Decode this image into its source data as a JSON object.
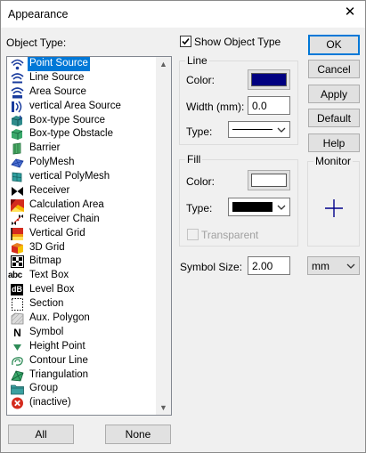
{
  "window": {
    "title": "Appearance",
    "close_glyph": "✕"
  },
  "object_type_label": "Object Type:",
  "object_types": [
    {
      "label": "Point Source",
      "icon": "point-source-icon",
      "selected": true
    },
    {
      "label": "Line Source",
      "icon": "line-source-icon"
    },
    {
      "label": "Area Source",
      "icon": "area-source-icon"
    },
    {
      "label": "vertical Area Source",
      "icon": "vertical-area-source-icon"
    },
    {
      "label": "Box-type Source",
      "icon": "box-source-icon"
    },
    {
      "label": "Box-type Obstacle",
      "icon": "box-obstacle-icon"
    },
    {
      "label": "Barrier",
      "icon": "barrier-icon"
    },
    {
      "label": "PolyMesh",
      "icon": "polymesh-icon"
    },
    {
      "label": "vertical PolyMesh",
      "icon": "vertical-polymesh-icon"
    },
    {
      "label": "Receiver",
      "icon": "receiver-icon"
    },
    {
      "label": "Calculation Area",
      "icon": "calculation-area-icon"
    },
    {
      "label": "Receiver Chain",
      "icon": "receiver-chain-icon"
    },
    {
      "label": "Vertical Grid",
      "icon": "vertical-grid-icon"
    },
    {
      "label": "3D Grid",
      "icon": "3d-grid-icon"
    },
    {
      "label": "Bitmap",
      "icon": "bitmap-icon"
    },
    {
      "label": "Text Box",
      "icon": "text-box-icon",
      "icon_text": "abc"
    },
    {
      "label": "Level Box",
      "icon": "level-box-icon",
      "icon_text": "dB"
    },
    {
      "label": "Section",
      "icon": "section-icon"
    },
    {
      "label": "Aux. Polygon",
      "icon": "aux-polygon-icon"
    },
    {
      "label": "Symbol",
      "icon": "symbol-icon",
      "icon_text": "N"
    },
    {
      "label": "Height Point",
      "icon": "height-point-icon"
    },
    {
      "label": "Contour Line",
      "icon": "contour-line-icon"
    },
    {
      "label": "Triangulation",
      "icon": "triangulation-icon"
    },
    {
      "label": "Group",
      "icon": "group-icon"
    },
    {
      "label": "(inactive)",
      "icon": "inactive-icon"
    }
  ],
  "buttons": {
    "all": "All",
    "none": "None",
    "ok": "OK",
    "cancel": "Cancel",
    "apply": "Apply",
    "default": "Default",
    "help": "Help"
  },
  "show_object_type": {
    "label": "Show Object Type",
    "checked": true
  },
  "line": {
    "group_label": "Line",
    "color_label": "Color:",
    "color": "#000080",
    "width_label": "Width (mm):",
    "width_value": "0.0",
    "type_label": "Type:"
  },
  "fill": {
    "group_label": "Fill",
    "color_label": "Color:",
    "color": "#ffffff",
    "type_label": "Type:",
    "transparent_label": "Transparent",
    "transparent_checked": false
  },
  "monitor": {
    "label": "Monitor",
    "marker_color": "#00008b"
  },
  "symbol_size": {
    "label": "Symbol Size:",
    "value": "2.00",
    "unit": "mm"
  },
  "colors": {
    "selection": "#0078d7",
    "default_button_border": "#0078d7"
  }
}
